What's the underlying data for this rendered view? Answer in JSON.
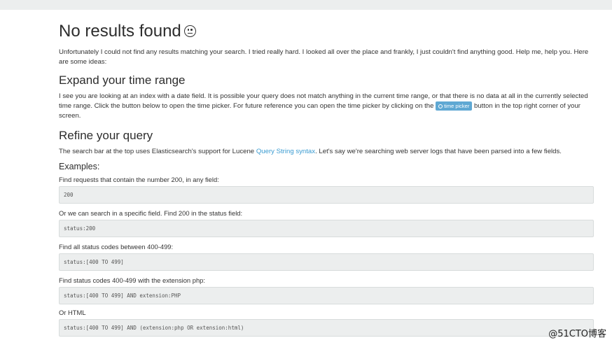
{
  "heading": "No results found",
  "intro": "Unfortunately I could not find any results matching your search. I tried really hard. I looked all over the place and frankly, I just couldn't find anything good. Help me, help you. Here are some ideas:",
  "time_section": {
    "title": "Expand your time range",
    "text_before": "I see you are looking at an index with a date field. It is possible your query does not match anything in the current time range, or that there is no data at all in the currently selected time range. Click the button below to open the time picker. For future reference you can open the time picker by clicking on the",
    "button_label": "time picker",
    "text_after": "button in the top right corner of your screen."
  },
  "query_section": {
    "title": "Refine your query",
    "text_before": "The search bar at the top uses Elasticsearch's support for Lucene",
    "link_text": "Query String syntax",
    "text_after": ". Let's say we're searching web server logs that have been parsed into a few fields.",
    "examples_title": "Examples:",
    "examples": [
      {
        "label": "Find requests that contain the number 200, in any field:",
        "code": "200"
      },
      {
        "label": "Or we can search in a specific field. Find 200 in the status field:",
        "code": "status:200"
      },
      {
        "label": "Find all status codes between 400-499:",
        "code": "status:[400 TO 499]"
      },
      {
        "label": "Find status codes 400-499 with the extension php:",
        "code": "status:[400 TO 499] AND extension:PHP"
      },
      {
        "label": "Or HTML",
        "code": "status:[400 TO 499] AND (extension:php OR extension:html)"
      }
    ]
  },
  "watermark": "@51CTO博客"
}
